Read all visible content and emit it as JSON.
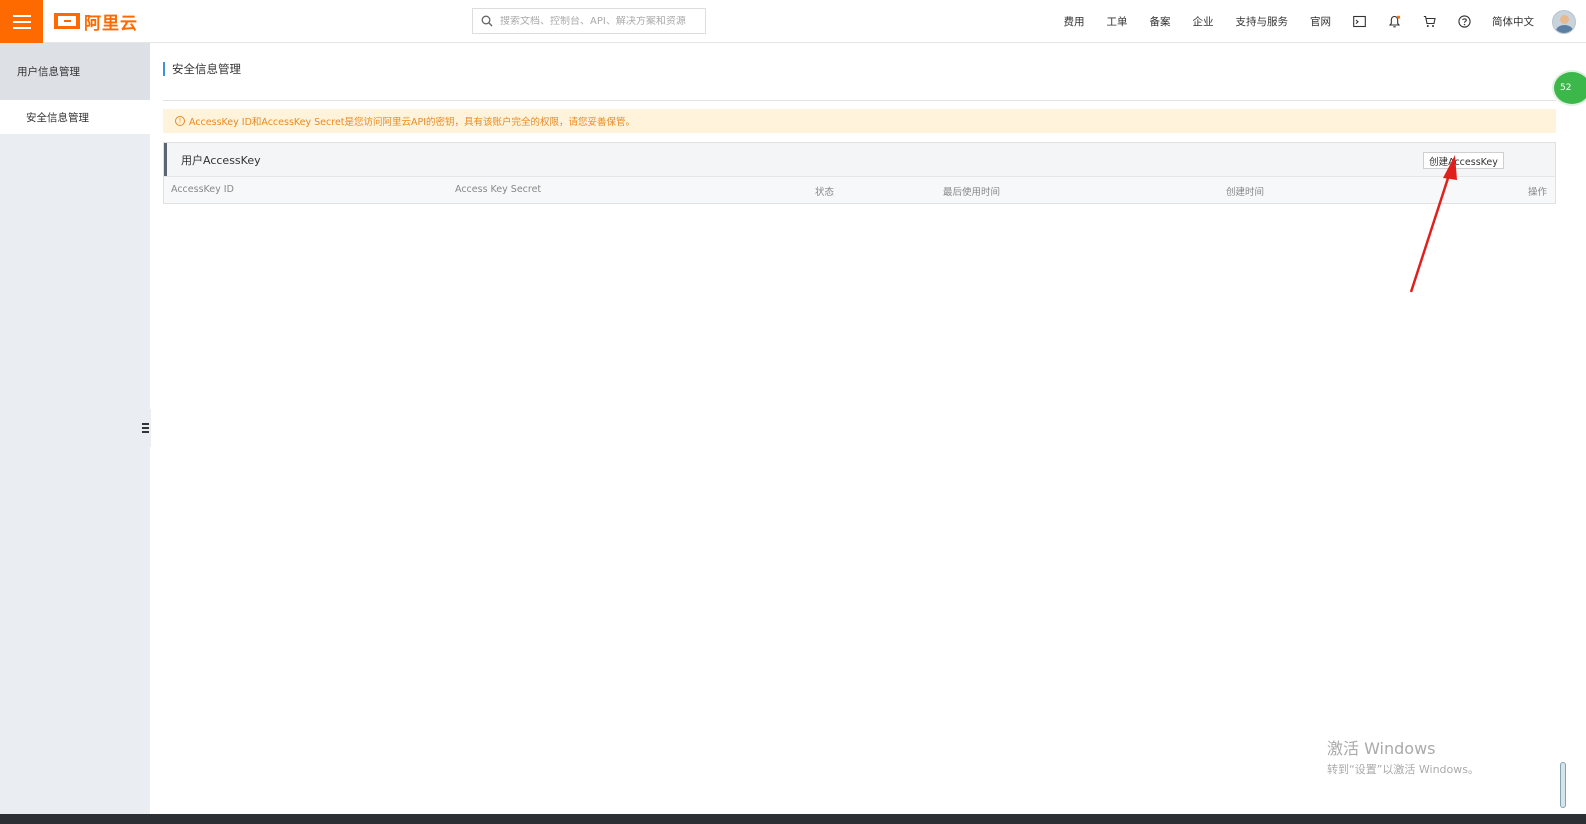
{
  "header": {
    "logo_text": "阿里云",
    "search_placeholder": "搜索文档、控制台、API、解决方案和资源",
    "nav": [
      "费用",
      "工单",
      "备案",
      "企业",
      "支持与服务",
      "官网"
    ],
    "icons": [
      "terminal-icon",
      "bell-icon",
      "cart-icon",
      "help-icon"
    ],
    "language": "简体中文"
  },
  "sidebar": {
    "section": "用户信息管理",
    "items": [
      {
        "label": "安全信息管理",
        "active": true
      }
    ]
  },
  "main": {
    "title": "安全信息管理",
    "warning": "AccessKey ID和AccessKey Secret是您访问阿里云API的密钥，具有该账户完全的权限，请您妥善保管。",
    "panel": {
      "title": "用户AccessKey",
      "create_button": "创建AccessKey",
      "columns": [
        "AccessKey ID",
        "Access Key Secret",
        "状态",
        "最后使用时间",
        "创建时间",
        "操作"
      ]
    }
  },
  "watermark": {
    "title": "激活 Windows",
    "subtitle": "转到“设置”以激活 Windows。"
  },
  "colors": {
    "brand": "#ff6a00",
    "warning_text": "#e98a1f",
    "warning_bg": "#fff3dc",
    "annotation_arrow": "#e0201d"
  }
}
